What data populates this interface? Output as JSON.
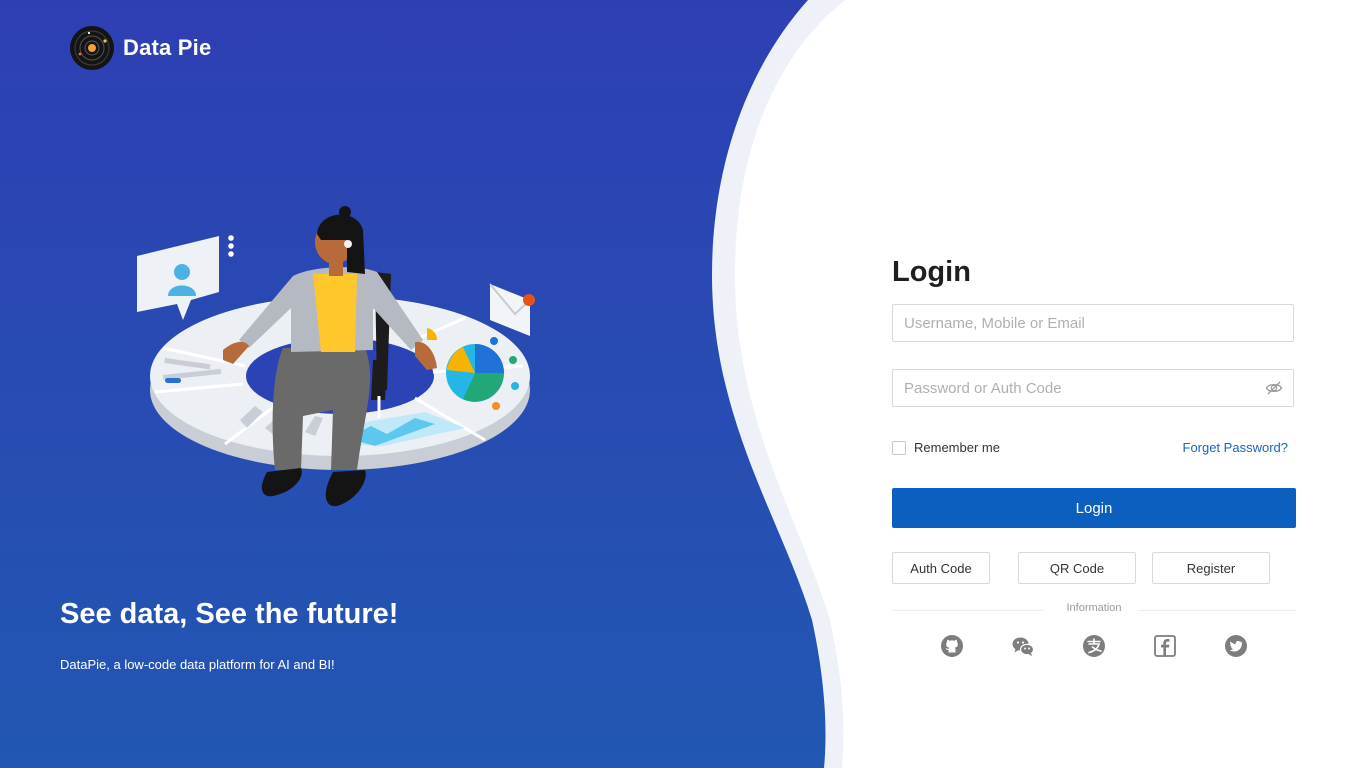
{
  "brand": {
    "name": "Data Pie"
  },
  "hero": {
    "headline": "See data, See the future!",
    "tagline": "DataPie, a low-code data platform for AI and BI!"
  },
  "login": {
    "title": "Login",
    "username_placeholder": "Username, Mobile or Email",
    "password_placeholder": "Password or Auth Code",
    "remember_label": "Remember me",
    "forget_label": "Forget Password?",
    "submit_label": "Login",
    "alt_buttons": {
      "auth_code": "Auth Code",
      "qr_code": "QR Code",
      "register": "Register"
    },
    "divider_label": "Information",
    "social_icons": [
      "github-icon",
      "wechat-icon",
      "alipay-icon",
      "facebook-icon",
      "twitter-icon"
    ]
  },
  "colors": {
    "brand_blue": "#2c43b5",
    "primary_button": "#0b5fbf",
    "link": "#1a63c2"
  }
}
